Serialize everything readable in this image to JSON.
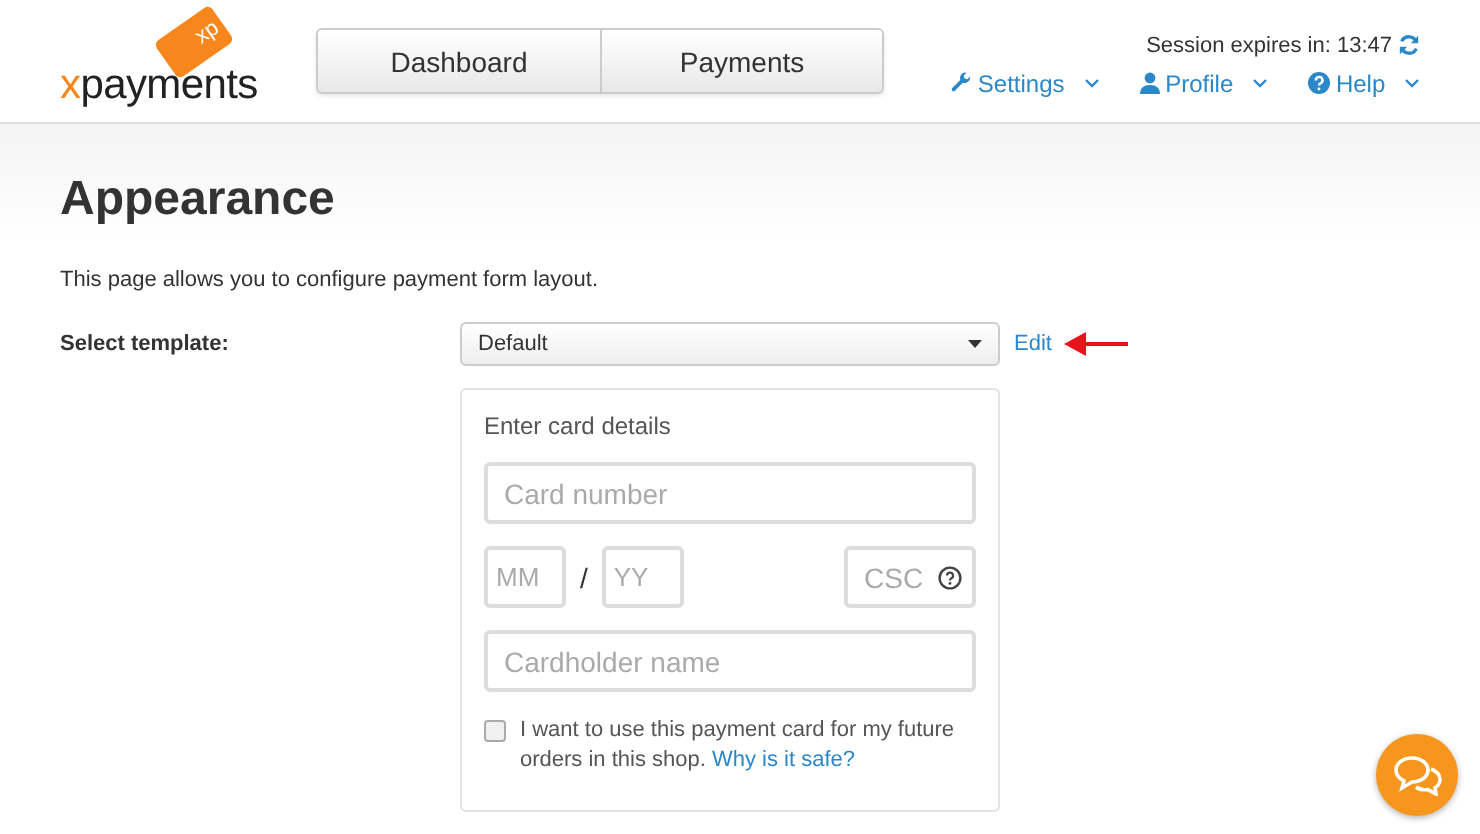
{
  "logo": {
    "tag": "xp",
    "prefix": "x",
    "name": "payments"
  },
  "nav": [
    {
      "label": "Dashboard",
      "selected": false
    },
    {
      "label": "Payments",
      "selected": false
    }
  ],
  "session": {
    "text": "Session expires in: 13:47"
  },
  "menu": [
    {
      "label": "Settings",
      "kind": "wrench"
    },
    {
      "label": "Profile",
      "kind": "user"
    },
    {
      "label": "Help",
      "kind": "help"
    }
  ],
  "page": {
    "title": "Appearance",
    "description": "This page allows you to configure payment form layout."
  },
  "template": {
    "label": "Select template:",
    "value": "Default",
    "edit": "Edit"
  },
  "card_form": {
    "title": "Enter card details",
    "card_number": {
      "placeholder": "Card number"
    },
    "month": {
      "placeholder": "MM"
    },
    "separator": "/",
    "year": {
      "placeholder": "YY"
    },
    "csc": {
      "placeholder": "CSC"
    },
    "cardholder": {
      "placeholder": "Cardholder name"
    },
    "save_card": {
      "checked": false,
      "text": "I want to use this payment card for my future orders in this shop.",
      "link": "Why is it safe?"
    }
  }
}
